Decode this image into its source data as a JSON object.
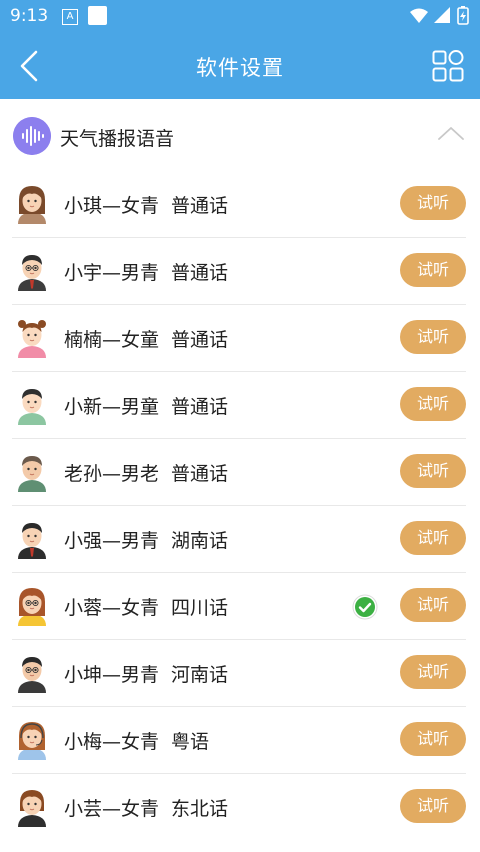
{
  "status": {
    "time": "9:13"
  },
  "header": {
    "title": "软件设置"
  },
  "section": {
    "title": "天气播报语音"
  },
  "voices": [
    {
      "name": "小琪—女青",
      "dialect": "普通话",
      "button": "试听",
      "selected": false,
      "avatar": "female-young"
    },
    {
      "name": "小宇—男青",
      "dialect": "普通话",
      "button": "试听",
      "selected": false,
      "avatar": "male-glasses"
    },
    {
      "name": "楠楠—女童",
      "dialect": "普通话",
      "button": "试听",
      "selected": false,
      "avatar": "girl-child"
    },
    {
      "name": "小新—男童",
      "dialect": "普通话",
      "button": "试听",
      "selected": false,
      "avatar": "boy-child"
    },
    {
      "name": "老孙—男老",
      "dialect": "普通话",
      "button": "试听",
      "selected": false,
      "avatar": "male-old"
    },
    {
      "name": "小强—男青",
      "dialect": "湖南话",
      "button": "试听",
      "selected": false,
      "avatar": "male-young"
    },
    {
      "name": "小蓉—女青",
      "dialect": "四川话",
      "button": "试听",
      "selected": true,
      "avatar": "female-glasses"
    },
    {
      "name": "小坤—男青",
      "dialect": "河南话",
      "button": "试听",
      "selected": false,
      "avatar": "male-beard"
    },
    {
      "name": "小梅—女青",
      "dialect": "粤语",
      "button": "试听",
      "selected": false,
      "avatar": "female-headset"
    },
    {
      "name": "小芸—女青",
      "dialect": "东北话",
      "button": "试听",
      "selected": false,
      "avatar": "female-short"
    }
  ],
  "colors": {
    "bar": "#4aa6e6",
    "button": "#e2ab61",
    "badge": "#8c7fee",
    "check": "#3cb043"
  }
}
